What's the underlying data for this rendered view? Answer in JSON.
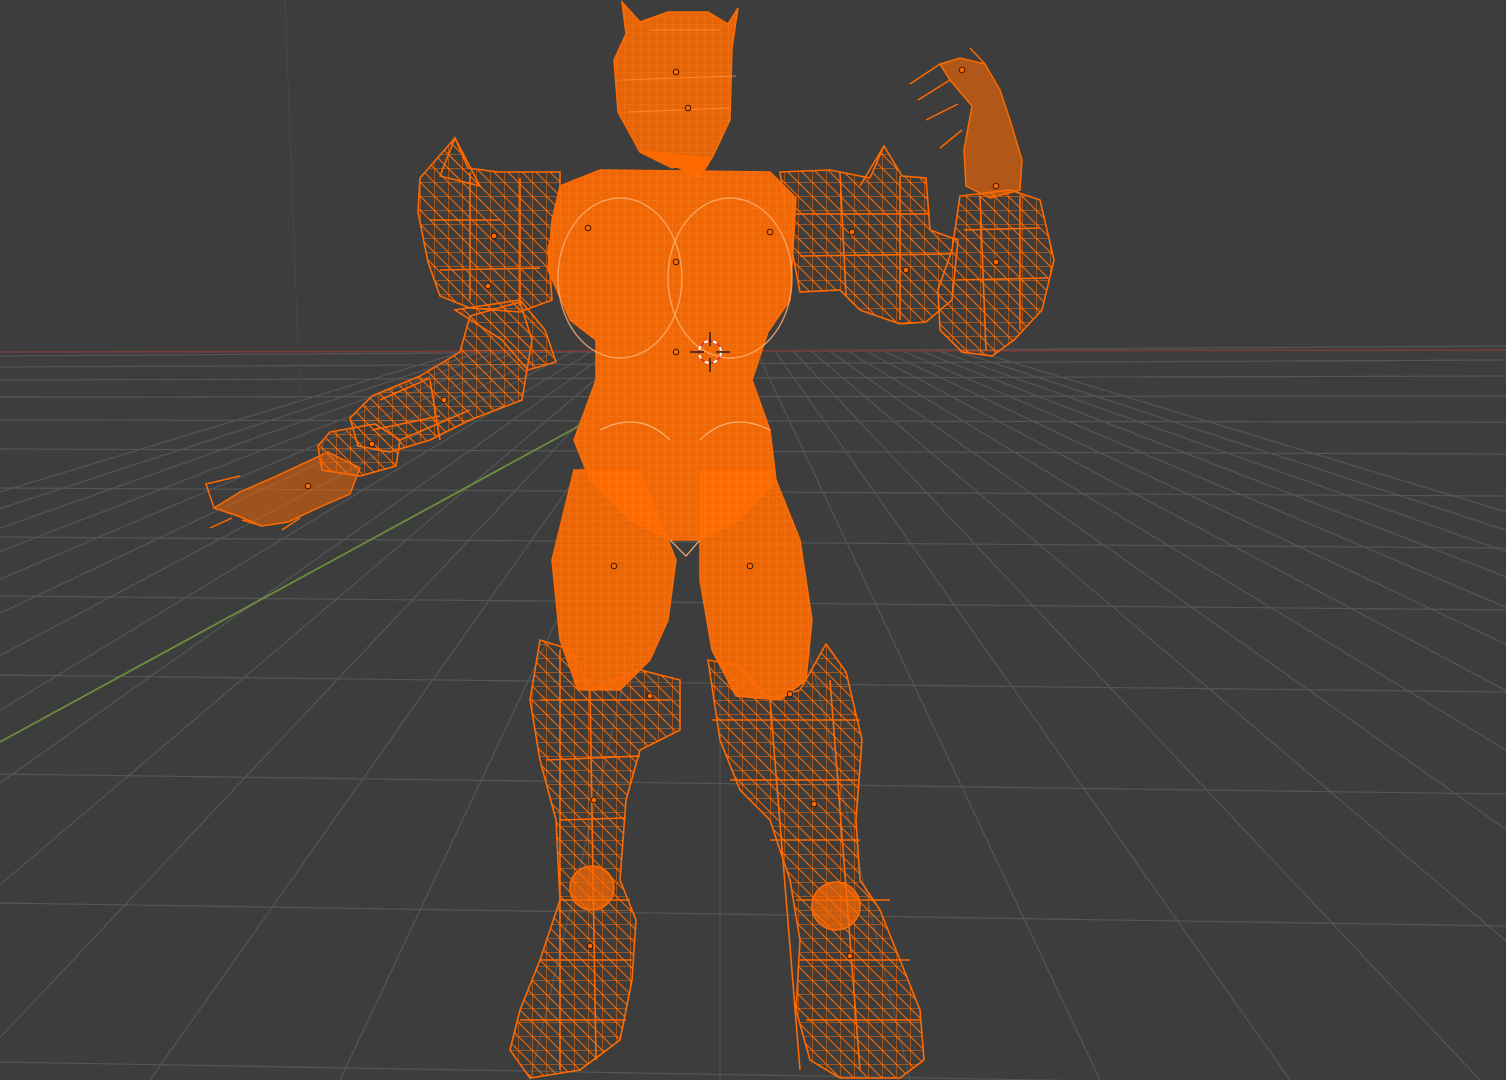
{
  "viewport": {
    "view_mode": "wireframe",
    "background_color": "#3d3d3d",
    "grid_color": "#555555",
    "x_axis_color": "#7a3b3b",
    "y_axis_color": "#6b8f3a",
    "selection_color": "#ff6a00",
    "selection_fill": "#ff6a00",
    "origin_dot_color": "#ff6a00",
    "cursor_color": "#ffffff",
    "cursor_accent": "#d83a3a"
  },
  "icons": {
    "cursor": "3d-cursor-icon",
    "origin": "object-origin-icon"
  }
}
